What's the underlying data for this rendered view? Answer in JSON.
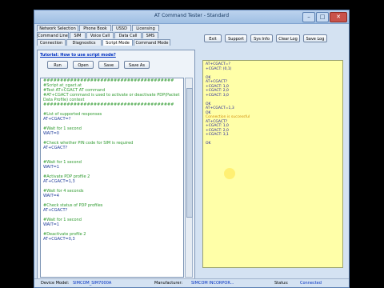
{
  "window": {
    "title": "AT Command Tester - Standard"
  },
  "tabs_row1": [
    "Network Selection",
    "Phone Book",
    "USSD",
    "Licensing"
  ],
  "tabs_row2": [
    "Command Line",
    "SIM",
    "Voice Call",
    "Data Call",
    "SMS"
  ],
  "tabs_row3": [
    "Connection",
    "Diagnostics",
    "Script Mode",
    "Command Mode"
  ],
  "tutorial_link": "Tutorial: How to use script mode?",
  "script_buttons": [
    "Run",
    "Open",
    "Save",
    "Save As"
  ],
  "right_buttons": [
    "Exit",
    "Support",
    "Sys Info",
    "Clear Log",
    "Save Log"
  ],
  "script_lines": [
    {
      "t": "#######################################",
      "k": "hash"
    },
    {
      "t": "#Script at_cgact.at",
      "k": "comment"
    },
    {
      "t": "#Test AT+CGACT AT command",
      "k": "comment"
    },
    {
      "t": "#AT+CGACT command is used to activate or deactivate PDP(Packet",
      "k": "comment"
    },
    {
      "t": "Data Profile) context",
      "k": "comment"
    },
    {
      "t": "#######################################",
      "k": "hash"
    },
    {
      "t": "",
      "k": "cmd"
    },
    {
      "t": "#List of supported responses",
      "k": "comment"
    },
    {
      "t": "AT+CGACT=?",
      "k": "cmd"
    },
    {
      "t": "",
      "k": "cmd"
    },
    {
      "t": "#Wait for 1 second",
      "k": "comment"
    },
    {
      "t": "WAIT=0",
      "k": "cmd"
    },
    {
      "t": "",
      "k": "cmd"
    },
    {
      "t": "#Check whether PIN code for SIM is required",
      "k": "comment"
    },
    {
      "t": "AT+CGACT?",
      "k": "cmd"
    },
    {
      "t": "",
      "k": "cmd"
    },
    {
      "t": "",
      "k": "cmd"
    },
    {
      "t": "#Wait for 1 second",
      "k": "comment"
    },
    {
      "t": "WAIT=1",
      "k": "cmd"
    },
    {
      "t": "",
      "k": "cmd"
    },
    {
      "t": "#Activate PDP profile 2",
      "k": "comment"
    },
    {
      "t": "AT+CGACT=1,3",
      "k": "cmd"
    },
    {
      "t": "",
      "k": "cmd"
    },
    {
      "t": "#Wait for 4 seconds",
      "k": "comment"
    },
    {
      "t": "WAIT=4",
      "k": "cmd"
    },
    {
      "t": "",
      "k": "cmd"
    },
    {
      "t": "#Check status of PDP profiles",
      "k": "comment"
    },
    {
      "t": "AT+CGACT?",
      "k": "cmd"
    },
    {
      "t": "",
      "k": "cmd"
    },
    {
      "t": "#Wait for 1 second",
      "k": "comment"
    },
    {
      "t": "WAIT=1",
      "k": "cmd"
    },
    {
      "t": "",
      "k": "cmd"
    },
    {
      "t": "#Deactivate profile 2",
      "k": "comment"
    },
    {
      "t": "AT+CGACT=0,3",
      "k": "cmd"
    }
  ],
  "log_lines": [
    {
      "t": "AT+CGACT=?",
      "k": "normal"
    },
    {
      "t": "+CGACT: (0,1)",
      "k": "normal"
    },
    {
      "t": "",
      "k": "normal"
    },
    {
      "t": "OK",
      "k": "normal"
    },
    {
      "t": "AT+CGACT?",
      "k": "normal"
    },
    {
      "t": "+CGACT: 1,0",
      "k": "normal"
    },
    {
      "t": "+CGACT: 2,0",
      "k": "normal"
    },
    {
      "t": "+CGACT: 3,0",
      "k": "normal"
    },
    {
      "t": "",
      "k": "normal"
    },
    {
      "t": "OK",
      "k": "normal"
    },
    {
      "t": "AT+CGACT=1,3",
      "k": "normal"
    },
    {
      "t": "OK",
      "k": "normal"
    },
    {
      "t": "Connection is successful",
      "k": "warn"
    },
    {
      "t": "AT+CGACT?",
      "k": "normal"
    },
    {
      "t": "+CGACT: 1,0",
      "k": "normal"
    },
    {
      "t": "+CGACT: 2,0",
      "k": "normal"
    },
    {
      "t": "+CGACT: 3,1",
      "k": "normal"
    },
    {
      "t": "",
      "k": "normal"
    },
    {
      "t": "OK",
      "k": "normal"
    }
  ],
  "status": {
    "device_label": "Device Model:",
    "device_value": "SIMCOM_SIM7000A",
    "manufacturer_label": "Manufacturer:",
    "manufacturer_value": "SIMCOM INCORPOR...",
    "status_label": "Status:",
    "status_value": "Connected"
  }
}
